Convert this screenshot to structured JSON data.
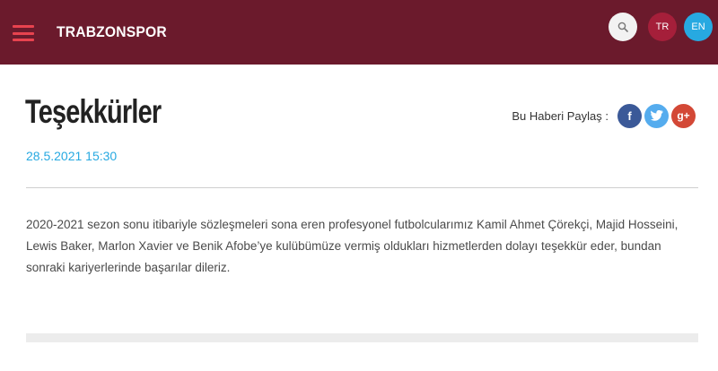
{
  "header": {
    "logo_text": "TRABZONSPOR",
    "languages": [
      "TR",
      "EN"
    ],
    "colors": {
      "background": "#6b1a2c",
      "menu": "#e8434f",
      "lang_tr": "#a51f3a",
      "lang_en": "#27a9e1"
    }
  },
  "icons": {
    "menu": "hamburger-menu-icon",
    "search": "search-icon",
    "share": [
      "facebook-icon",
      "twitter-icon",
      "google-plus-icon"
    ]
  },
  "article": {
    "title": "Teşekkürler",
    "date": "28.5.2021 15:30",
    "share_label": "Bu Haberi Paylaş :",
    "body": "2020-2021 sezon sonu itibariyle sözleşmeleri sona eren profesyonel futbolcularımız Kamil Ahmet Çörekçi, Majid Hosseini, Lewis Baker, Marlon Xavier ve Benik Afobe’ye kulübümüze vermiş oldukları hizmetlerden dolayı teşekkür eder, bundan sonraki kariyerlerinde başarılar dileriz."
  }
}
